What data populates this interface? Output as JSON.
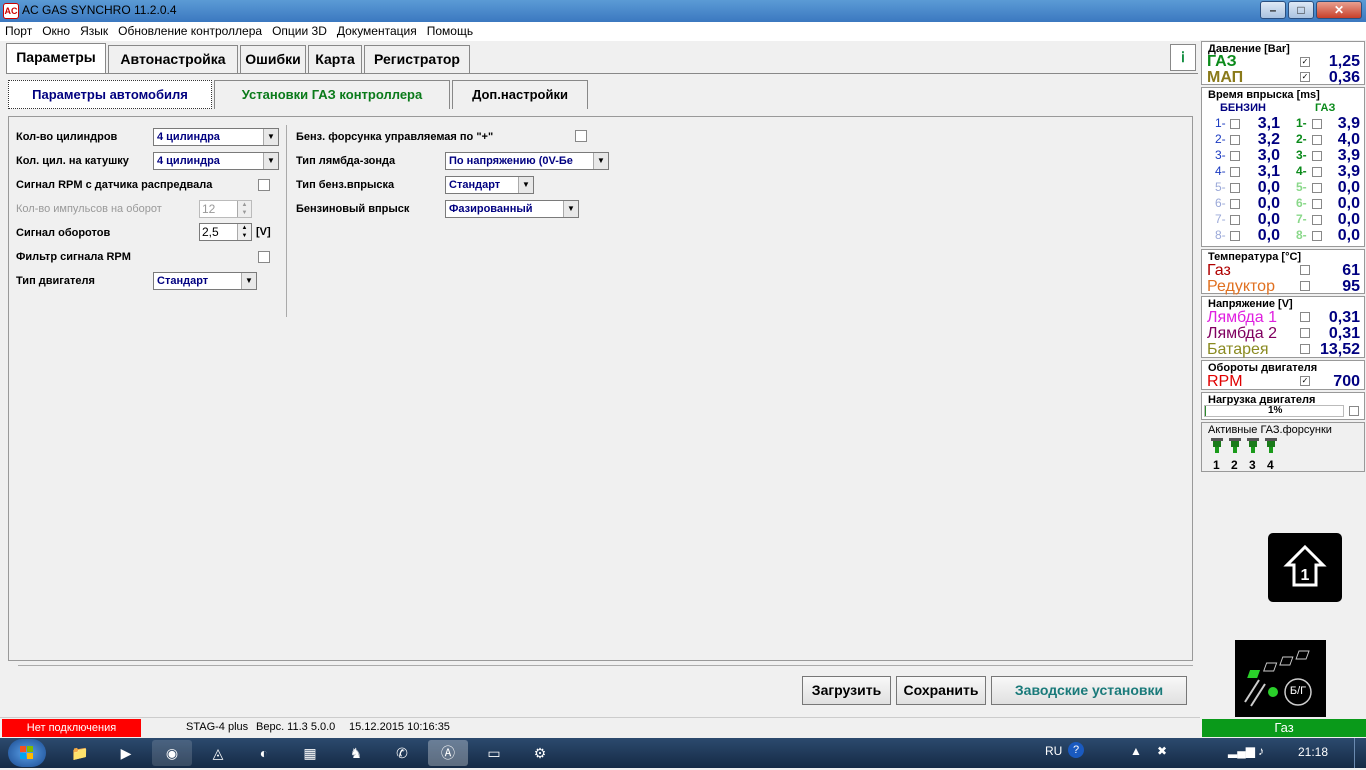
{
  "window": {
    "title": "AC GAS SYNCHRO  11.2.0.4",
    "app_icon_text": "AC",
    "minimize": "–",
    "maximize": "□",
    "close": "✕"
  },
  "menu": [
    "Порт",
    "Окно",
    "Язык",
    "Обновление контроллера",
    "Опции 3D",
    "Документация",
    "Помощь"
  ],
  "tabs": [
    "Параметры",
    "Автонастройка",
    "Ошибки",
    "Карта",
    "Регистратор"
  ],
  "subtabs": [
    "Параметры автомобиля",
    "Установки ГАЗ контроллера",
    "Доп.настройки"
  ],
  "left_params": {
    "cyl_label": "Кол-во цилиндров",
    "cyl_value": "4 цилиндра",
    "coil_label": "Кол. цил. на катушку",
    "coil_value": "4 цилиндра",
    "rpm_cam_label": "Сигнал RPM с датчика распредвала",
    "pulses_label": "Кол-во импульсов на оборот",
    "pulses_value": "12",
    "rev_signal_label": "Сигнал оборотов",
    "rev_signal_value": "2,5",
    "rev_signal_unit": "[V]",
    "rpm_filter_label": "Фильтр сигнала RPM",
    "engine_type_label": "Тип двигателя",
    "engine_type_value": "Стандарт"
  },
  "right_params": {
    "injector_plus_label": "Бенз. форсунка управляемая по \"+\"",
    "lambda_label": "Тип лямбда-зонда",
    "lambda_value": "По напряжению  (0V-Бе",
    "petrol_inj_type_label": "Тип бенз.впрыска",
    "petrol_inj_type_value": "Стандарт",
    "petrol_inj_label": "Бензиновый впрыск",
    "petrol_inj_value": "Фазированный"
  },
  "buttons": {
    "load": "Загрузить",
    "save": "Сохранить",
    "factory": "Заводские установки"
  },
  "status": {
    "connection": "Нет подключения",
    "controller": "STAG-4 plus",
    "version": "Верс. 11.3  5.0.0",
    "datetime": "15.12.2015 10:16:35",
    "connection_color": "#ff0000"
  },
  "pressure": {
    "header": "Давление [Bar]",
    "gas_label": "ГАЗ",
    "gas_value": "1,25",
    "map_label": "МАП",
    "map_value": "0,36"
  },
  "injection": {
    "header": "Время впрыска [ms]",
    "petrol_header": "БЕНЗИН",
    "gas_header": "ГАЗ",
    "rows": [
      {
        "n": "1-",
        "p": "3,1",
        "g": "3,9"
      },
      {
        "n": "2-",
        "p": "3,2",
        "g": "4,0"
      },
      {
        "n": "3-",
        "p": "3,0",
        "g": "3,9"
      },
      {
        "n": "4-",
        "p": "3,1",
        "g": "3,9"
      },
      {
        "n": "5-",
        "p": "0,0",
        "g": "0,0"
      },
      {
        "n": "6-",
        "p": "0,0",
        "g": "0,0"
      },
      {
        "n": "7-",
        "p": "0,0",
        "g": "0,0"
      },
      {
        "n": "8-",
        "p": "0,0",
        "g": "0,0"
      }
    ]
  },
  "temperature": {
    "header": "Температура  [°C]",
    "gas_label": "Газ",
    "gas_value": "61",
    "reducer_label": "Редуктор",
    "reducer_value": "95"
  },
  "voltage": {
    "header": "Напряжение [V]",
    "lambda1_label": "Лямбда 1",
    "lambda1_value": "0,31",
    "lambda2_label": "Лямбда 2",
    "lambda2_value": "0,31",
    "battery_label": "Батарея",
    "battery_value": "13,52"
  },
  "rpm": {
    "header": "Обороты двигателя",
    "label": "RPM",
    "value": "700"
  },
  "load": {
    "header": "Нагрузка двигателя",
    "value": "1%",
    "fraction": 0.01
  },
  "active_injectors": {
    "header": "Активные ГАЗ.форсунки",
    "numbers": [
      "1",
      "2",
      "3",
      "4"
    ]
  },
  "fuel_mode": {
    "switch_label": "Б/Г",
    "indicator": "Газ"
  },
  "taskbar": {
    "lang": "RU",
    "time": "21:18"
  },
  "check": "✓"
}
